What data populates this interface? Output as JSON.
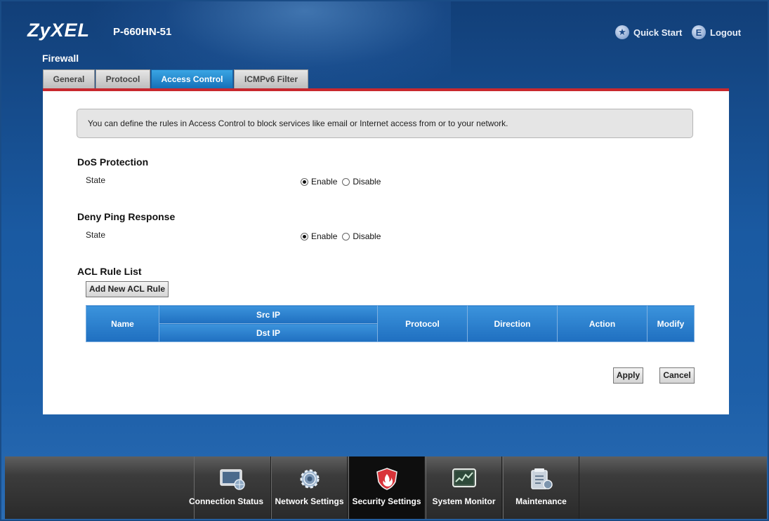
{
  "header": {
    "logo": "ZyXEL",
    "model": "P-660HN-51",
    "quick_start": "Quick Start",
    "logout": "Logout"
  },
  "page": {
    "title": "Firewall"
  },
  "tabs": [
    {
      "label": "General"
    },
    {
      "label": "Protocol"
    },
    {
      "label": "Access Control",
      "active": true
    },
    {
      "label": "ICMPv6 Filter"
    }
  ],
  "info_text": "You can define the rules in Access Control to block services like email or Internet access from or to your network.",
  "dos": {
    "title": "DoS Protection",
    "state_label": "State",
    "enable": "Enable",
    "disable": "Disable",
    "value": "Enable"
  },
  "deny_ping": {
    "title": "Deny Ping Response",
    "state_label": "State",
    "enable": "Enable",
    "disable": "Disable",
    "value": "Enable"
  },
  "acl": {
    "title": "ACL Rule List",
    "add_button": "Add New ACL Rule",
    "columns": {
      "name": "Name",
      "src_ip": "Src IP",
      "dst_ip": "Dst IP",
      "protocol": "Protocol",
      "direction": "Direction",
      "action": "Action",
      "modify": "Modify"
    }
  },
  "buttons": {
    "apply": "Apply",
    "cancel": "Cancel"
  },
  "bottom_nav": [
    {
      "label": "Connection Status",
      "icon": "connection-status-icon"
    },
    {
      "label": "Network Settings",
      "icon": "gear-icon"
    },
    {
      "label": "Security Settings",
      "icon": "shield-flame-icon",
      "active": true
    },
    {
      "label": "System Monitor",
      "icon": "monitor-chart-icon"
    },
    {
      "label": "Maintenance",
      "icon": "maintenance-tools-icon"
    }
  ],
  "colors": {
    "accent_red": "#c8282e",
    "tab_active": "#1a77c2",
    "table_header": "#2a7fcf"
  }
}
